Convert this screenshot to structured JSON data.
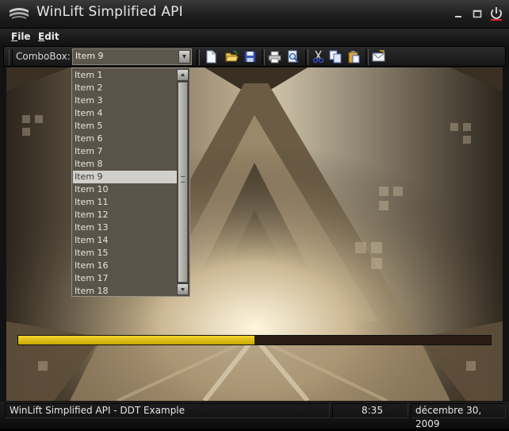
{
  "window": {
    "title": "WinLift Simplified API",
    "logo_icon": "winlift-logo-icon",
    "controls": [
      "minimize-icon",
      "maximize-icon",
      "power-icon"
    ]
  },
  "menubar": {
    "items": [
      {
        "label": "File",
        "mnemonic": "F",
        "rest": "ile"
      },
      {
        "label": "Edit",
        "mnemonic": "E",
        "rest": "dit"
      }
    ]
  },
  "toolbar": {
    "combo_label": "ComboBox:",
    "combo_value": "Item 9",
    "icons": [
      "new-document-icon",
      "open-folder-icon",
      "save-icon",
      "print-icon",
      "print-preview-icon",
      "cut-icon",
      "copy-icon",
      "paste-icon",
      "mail-icon"
    ]
  },
  "combo_dropdown": {
    "items": [
      "Item 1",
      "Item 2",
      "Item 3",
      "Item 4",
      "Item 5",
      "Item 6",
      "Item 7",
      "Item 8",
      "Item 9",
      "Item 10",
      "Item 11",
      "Item 12",
      "Item 13",
      "Item 14",
      "Item 15",
      "Item 16",
      "Item 17",
      "Item 18"
    ],
    "selected": "Item 9"
  },
  "progress": {
    "value": 0.5
  },
  "statusbar": {
    "text": "WinLift Simplified API - DDT Example",
    "time": "8:35",
    "date": "décembre 30, 2009"
  },
  "colors": {
    "progress_fill": "#e8c91a",
    "progress_track": "#2b1d15",
    "close_accent": "#d4282a"
  }
}
